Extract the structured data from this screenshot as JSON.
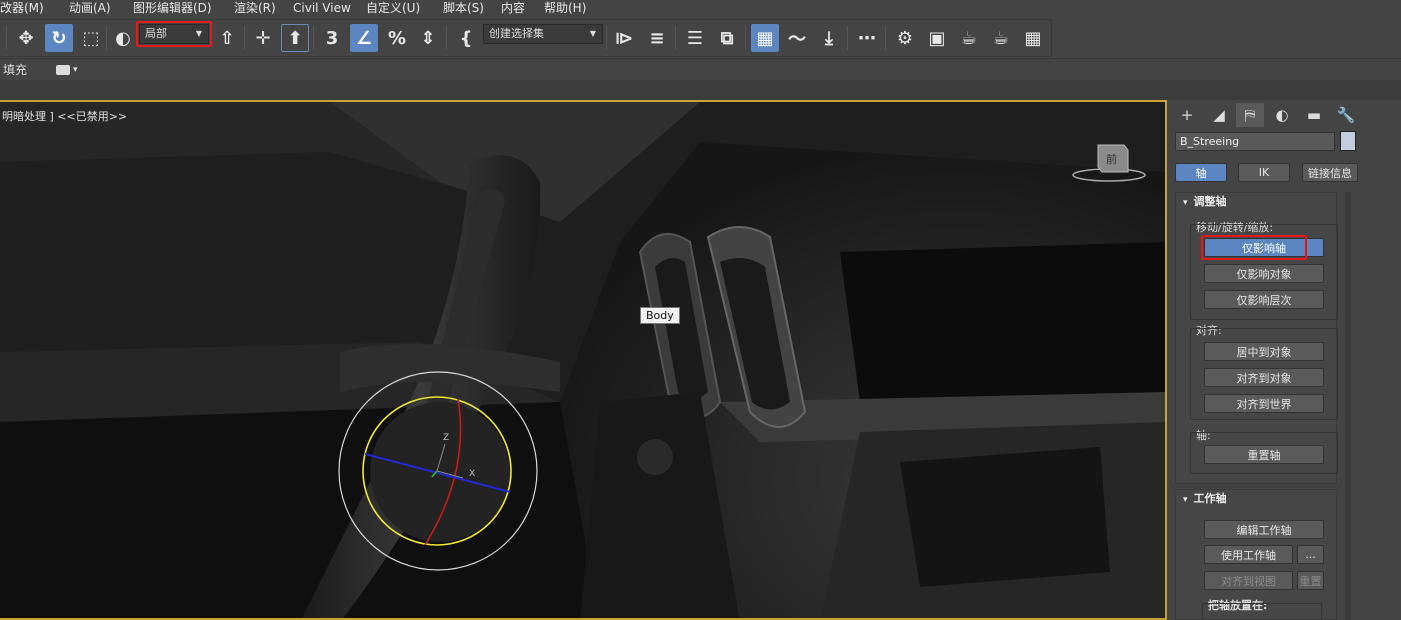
{
  "menubar": {
    "items": [
      "改器(M)",
      "动画(A)",
      "图形编辑器(D)",
      "渲染(R)",
      "Civil View",
      "自定义(U)",
      "脚本(S)",
      "内容",
      "帮助(H)"
    ]
  },
  "toolbar": {
    "coord_dropdown": "局部",
    "selection_set_dropdown": "创建选择集",
    "icons": {
      "move": "move-icon",
      "rotate": "rotate-icon",
      "scale": "scale-icon"
    },
    "glyphs": {
      "move": "✥",
      "rotate": "↻",
      "scale": "⬚",
      "select_pivot": "◐",
      "pivot_center": "⇧",
      "select_manip": "✛",
      "keyboard": "⬆",
      "snap3": "3",
      "angle_snap": "∠",
      "percent_snap": "%",
      "spinner_snap": "⇕",
      "edit_named": "{",
      "mirror": "⧐",
      "align": "≡",
      "scene_explorer": "☰",
      "layers": "⧉",
      "ribbon": "▦",
      "curve_editor": "〜",
      "dope": "⤓",
      "schematic": "⋯",
      "render_setup": "⚙",
      "rendered_frame": "▣",
      "render": "☕",
      "render_iter": "☕",
      "render_cloud": "▦"
    }
  },
  "ribbon": {
    "label": "填充",
    "dropdown_glyph": "▾"
  },
  "viewport": {
    "label": "明暗处理 ] <<已禁用>>",
    "tooltip": "Body",
    "gizmo_axes": {
      "x": "X",
      "z": "Z"
    },
    "viewcube_label": "前"
  },
  "command_panel": {
    "tabs": [
      "+",
      "◢",
      "⛿",
      "◐",
      "▬",
      "🔧"
    ],
    "object_name": "B_Streeing",
    "mode_buttons": [
      "轴",
      "IK",
      "链接信息"
    ],
    "adjust_pivot": {
      "title": "调整轴",
      "collapse_glyph": "▾",
      "move_rotate_scale_label": "移动/旋转/缩放:",
      "affect_pivot_only": "仅影响轴",
      "affect_object_only": "仅影响对象",
      "affect_hierarchy_only": "仅影响层次",
      "align_label": "对齐:",
      "center_to_object": "居中到对象",
      "align_to_object": "对齐到对象",
      "align_to_world": "对齐到世界",
      "pivot_label": "轴:",
      "reset_pivot": "重置轴"
    },
    "working_pivot": {
      "title": "工作轴",
      "collapse_glyph": "▾",
      "edit_working_pivot": "编辑工作轴",
      "use_working_pivot": "使用工作轴",
      "more": "...",
      "align_to_view": "对齐到视图",
      "reset": "重置",
      "place_pivot_label": "把轴放置在:"
    }
  },
  "colors": {
    "accent": "#5b86c2",
    "highlight": "#e21a1a",
    "viewport_border": "#c8a32f"
  }
}
